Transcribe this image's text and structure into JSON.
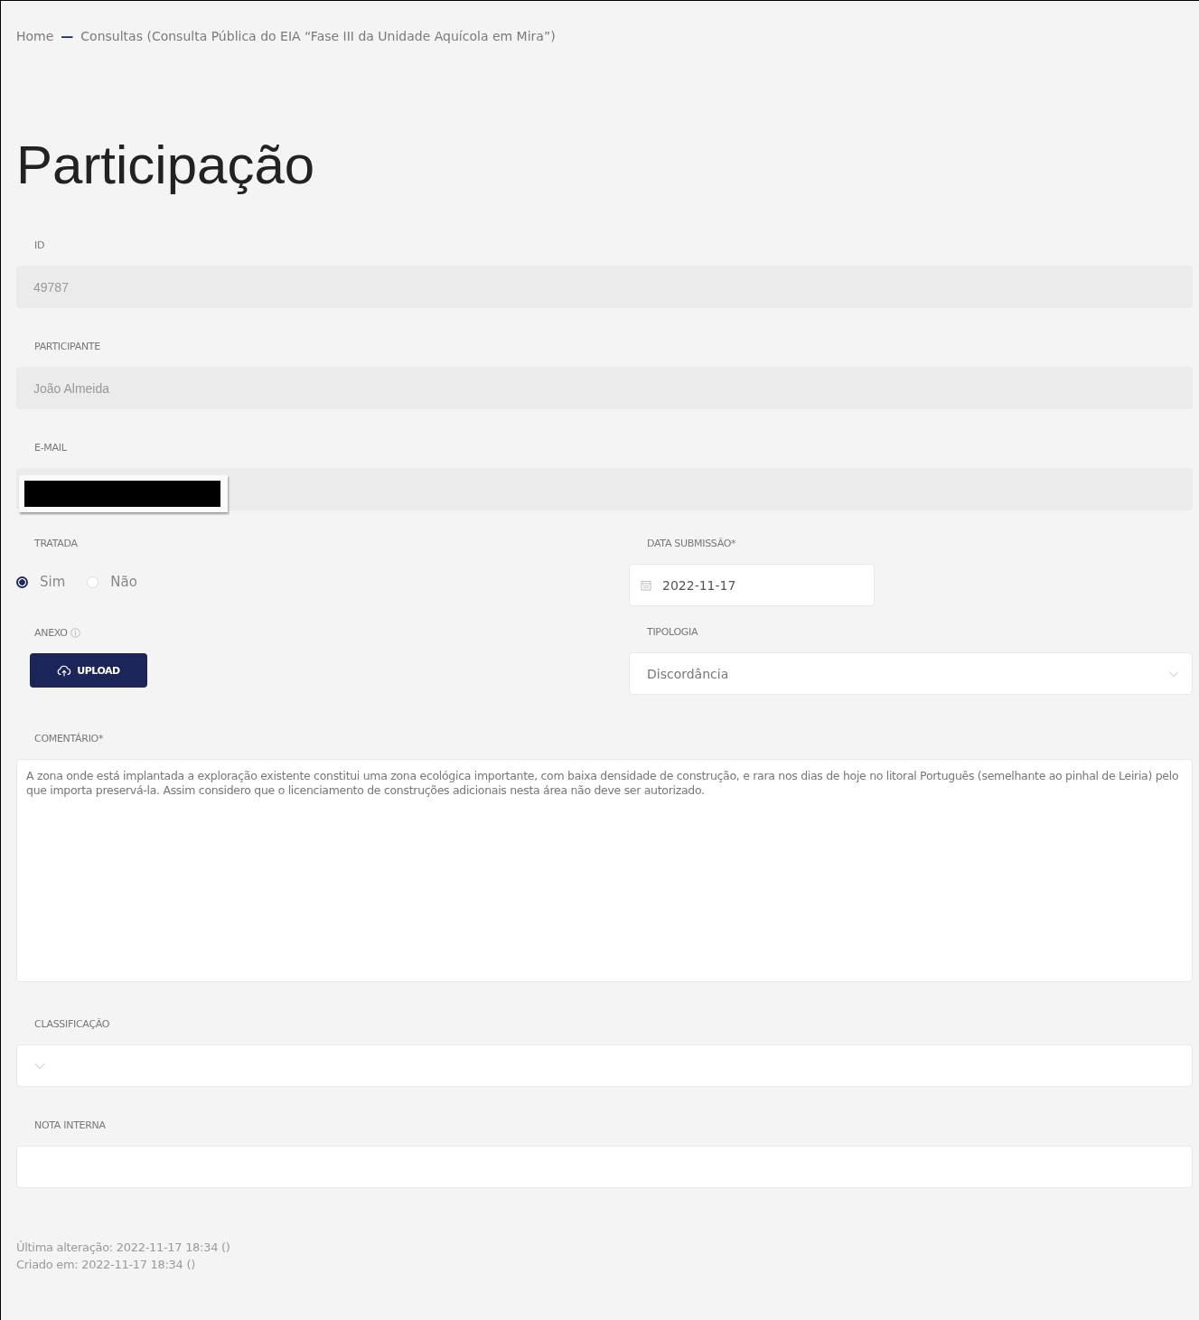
{
  "breadcrumb": {
    "home": "Home",
    "separator": "—",
    "current": "Consultas (Consulta Pública do EIA “Fase III da Unidade Aquícola em Mira”)"
  },
  "title": "Participação",
  "id": {
    "label": "ID",
    "value": "49787",
    "disabled": true
  },
  "participant": {
    "label": "PARTICIPANTE",
    "value": "João Almeida",
    "disabled": true
  },
  "email": {
    "label": "E-MAIL",
    "redacted": true,
    "disabled": true
  },
  "treated": {
    "label": "TRATADA",
    "options": [
      {
        "label": "Sim",
        "selected": true
      },
      {
        "label": "Não",
        "selected": false
      }
    ]
  },
  "submission_date": {
    "label": "DATA SUBMISSÃO*",
    "value": "2022-11-17"
  },
  "attachment": {
    "label": "ANEXO",
    "button": "UPLOAD"
  },
  "typology": {
    "label": "TIPOLOGIA",
    "value": "Discordância"
  },
  "comment": {
    "label": "COMENTÁRIO*",
    "value": "A zona onde está implantada a exploração existente constitui uma zona ecológica importante, com baixa densidade de construção,  e rara nos dias de hoje no litoral Português (semelhante ao pinhal de Leiria)  pelo que importa preservá-la. Assim considero que o licenciamento de construções adicionais nesta área não deve ser autorizado."
  },
  "classification": {
    "label": "CLASSIFICAÇÃO"
  },
  "internal_note": {
    "label": "NOTA INTERNA"
  },
  "footer": [
    "Última alteração: 2022-11-17 18:34 ()",
    "Criado em: 2022-11-17 18:34 ()"
  ]
}
